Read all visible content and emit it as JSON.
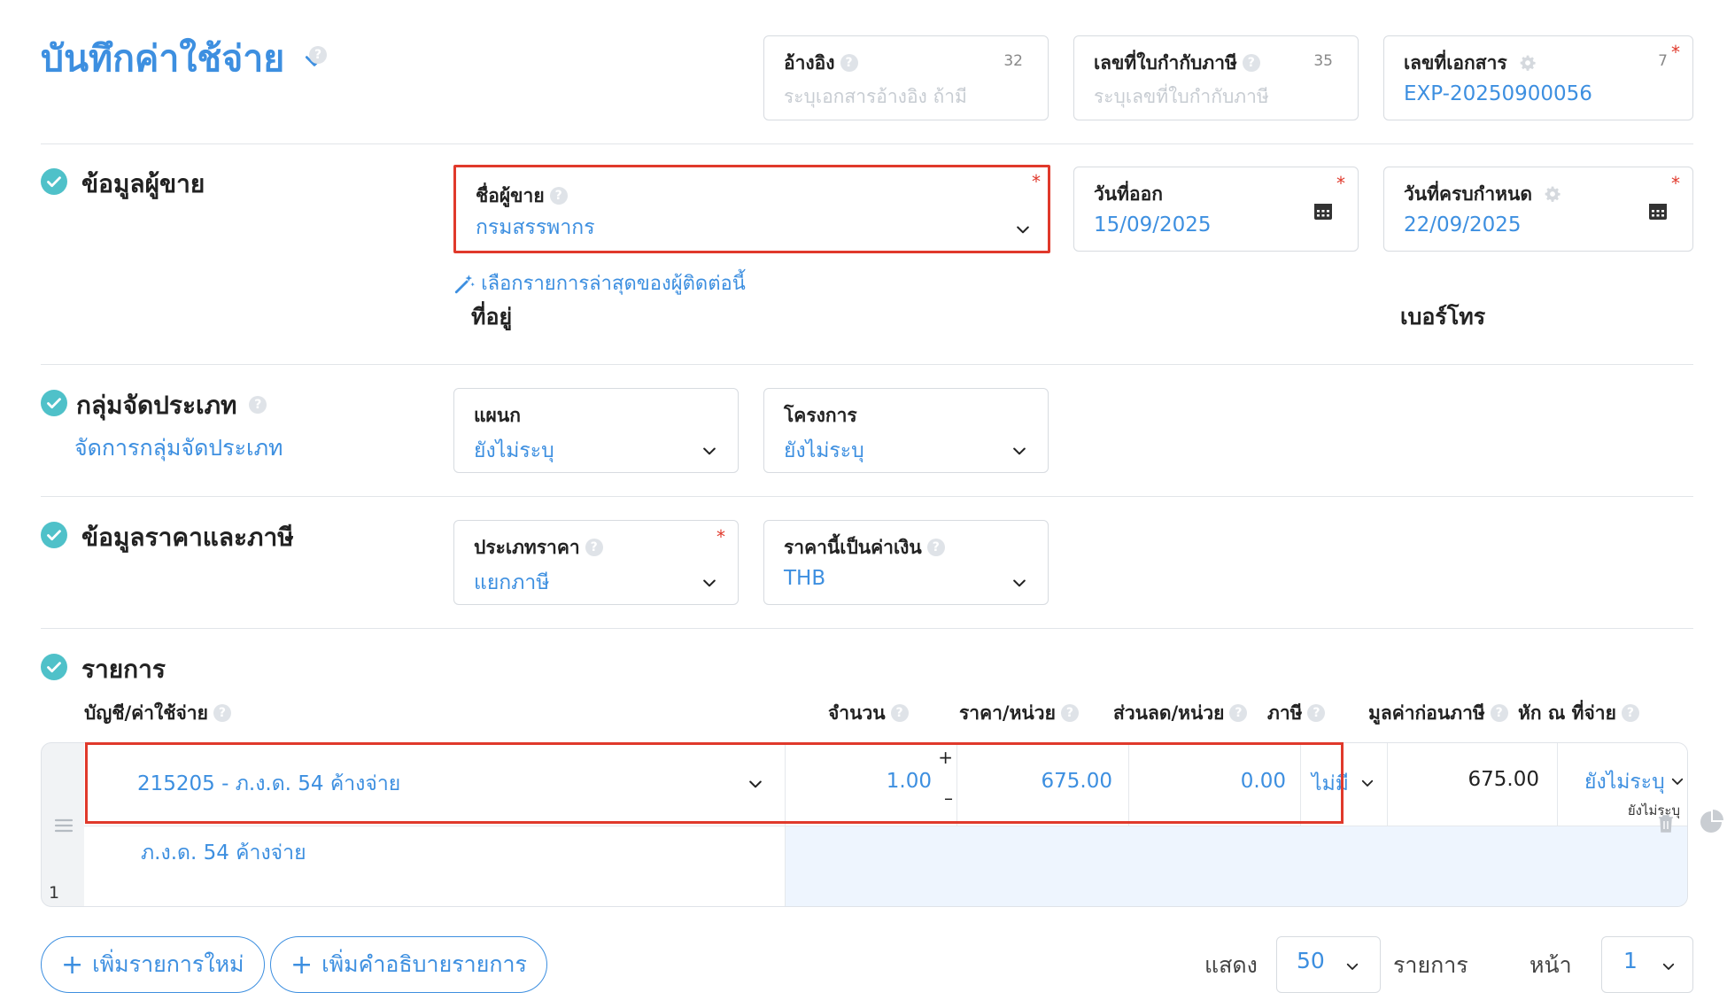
{
  "header": {
    "title": "บันทึกค่าใช้จ่าย",
    "reference": {
      "label": "อ้างอิง",
      "counter": "32",
      "placeholder": "ระบุเอกสารอ้างอิง ถ้ามี"
    },
    "tax_invoice_no": {
      "label": "เลขที่ใบกำกับภาษี",
      "counter": "35",
      "placeholder": "ระบุเลขที่ใบกำกับภาษี"
    },
    "document_no": {
      "label": "เลขที่เอกสาร",
      "counter": "7",
      "value": "EXP-20250900056"
    }
  },
  "vendor_section": {
    "title": "ข้อมูลผู้ขาย",
    "vendor_name": {
      "label": "ชื่อผู้ขาย",
      "value": "กรมสรรพากร"
    },
    "issue_date": {
      "label": "วันที่ออก",
      "value": "15/09/2025"
    },
    "due_date": {
      "label": "วันที่ครบกำหนด",
      "value": "22/09/2025"
    },
    "recent_link": "เลือกรายการล่าสุดของผู้ติดต่อนี้",
    "address_label": "ที่อยู่",
    "phone_label": "เบอร์โทร"
  },
  "classification_section": {
    "title": "กลุ่มจัดประเภท",
    "manage_link": "จัดการกลุ่มจัดประเภท",
    "department": {
      "label": "แผนก",
      "value": "ยังไม่ระบุ"
    },
    "project": {
      "label": "โครงการ",
      "value": "ยังไม่ระบุ"
    }
  },
  "pricing_section": {
    "title": "ข้อมูลราคาและภาษี",
    "price_type": {
      "label": "ประเภทราคา",
      "value": "แยกภาษี"
    },
    "currency": {
      "label": "ราคานี้เป็นค่าเงิน",
      "value": "THB"
    }
  },
  "items_section": {
    "title": "รายการ",
    "columns": {
      "account": "บัญชี/ค่าใช้จ่าย",
      "qty": "จำนวน",
      "unit_price": "ราคา/หน่วย",
      "discount": "ส่วนลด/หน่วย",
      "tax": "ภาษี",
      "pre_tax": "มูลค่าก่อนภาษี",
      "wht": "หัก ณ ที่จ่าย"
    },
    "rows": [
      {
        "index": "1",
        "account": "215205 - ภ.ง.ด. 54 ค้างจ่าย",
        "description": "ภ.ง.ด. 54 ค้างจ่าย",
        "qty": "1.00",
        "unit_price": "675.00",
        "discount": "0.00",
        "tax": "ไม่มี",
        "pre_tax": "675.00",
        "wht": "ยังไม่ระบุ",
        "wht_sub": "ยังไม่ระบุ"
      }
    ]
  },
  "footer": {
    "add_item": "เพิ่มรายการใหม่",
    "add_description": "เพิ่มคำอธิบายรายการ",
    "show_label": "แสดง",
    "page_size": "50",
    "items_label": "รายการ",
    "page_label": "หน้า",
    "page": "1"
  },
  "colors": {
    "accent": "#3d8fe0",
    "check": "#4fc1c9",
    "highlight": "#e0392b",
    "required": "#e0392b"
  }
}
